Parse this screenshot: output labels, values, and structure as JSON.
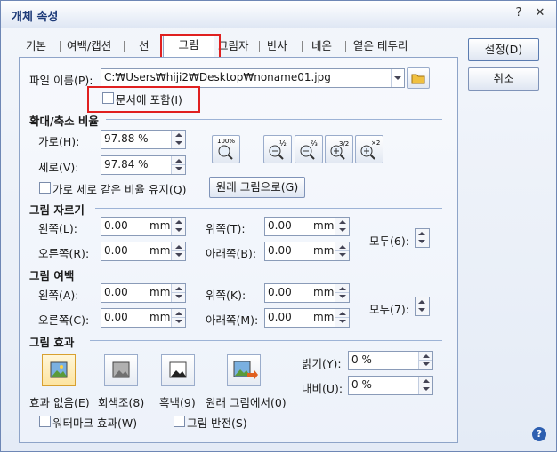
{
  "window": {
    "title": "개체 속성",
    "help": "?",
    "close": "✕"
  },
  "tabs": [
    "기본",
    "여백/캡션",
    "선",
    "그림",
    "그림자",
    "반사",
    "네온",
    "옅은 테두리"
  ],
  "file": {
    "label": "파일 이름(P):",
    "path": "C:₩Users₩hiji2₩Desktop₩noname01.jpg",
    "embed_label": "문서에 포함(I)"
  },
  "scale": {
    "title": "확대/축소 비율",
    "width_label": "가로(H):",
    "width_value": "97.88 %",
    "height_label": "세로(V):",
    "height_value": "97.84 %",
    "keep_ratio_label": "가로 세로 같은 비율 유지(Q)",
    "original_button": "원래 그림으로(G)",
    "zoom_icons": [
      "100%",
      "½",
      "⅔",
      "3/2",
      "×2"
    ]
  },
  "crop": {
    "title": "그림 자르기",
    "left_label": "왼쪽(L):",
    "left_value": "0.00",
    "unit": "mm",
    "right_label": "오른쪽(R):",
    "right_value": "0.00",
    "top_label": "위쪽(T):",
    "top_value": "0.00",
    "bottom_label": "아래쪽(B):",
    "bottom_value": "0.00",
    "all_label": "모두(6):"
  },
  "margin": {
    "title": "그림 여백",
    "left_label": "왼쪽(A):",
    "left_value": "0.00",
    "unit": "mm",
    "right_label": "오른쪽(C):",
    "right_value": "0.00",
    "top_label": "위쪽(K):",
    "top_value": "0.00",
    "bottom_label": "아래쪽(M):",
    "bottom_value": "0.00",
    "all_label": "모두(7):"
  },
  "effect": {
    "title": "그림 효과",
    "none_label": "효과 없음(E)",
    "gray_label": "회색조(8)",
    "bw_label": "흑백(9)",
    "original_label": "원래 그림에서(0)",
    "brightness_label": "밝기(Y):",
    "brightness_value": "0 %",
    "contrast_label": "대비(U):",
    "contrast_value": "0 %",
    "watermark_label": "워터마크 효과(W)",
    "invert_label": "그림 반전(S)"
  },
  "buttons": {
    "ok": "설정(D)",
    "cancel": "취소"
  }
}
